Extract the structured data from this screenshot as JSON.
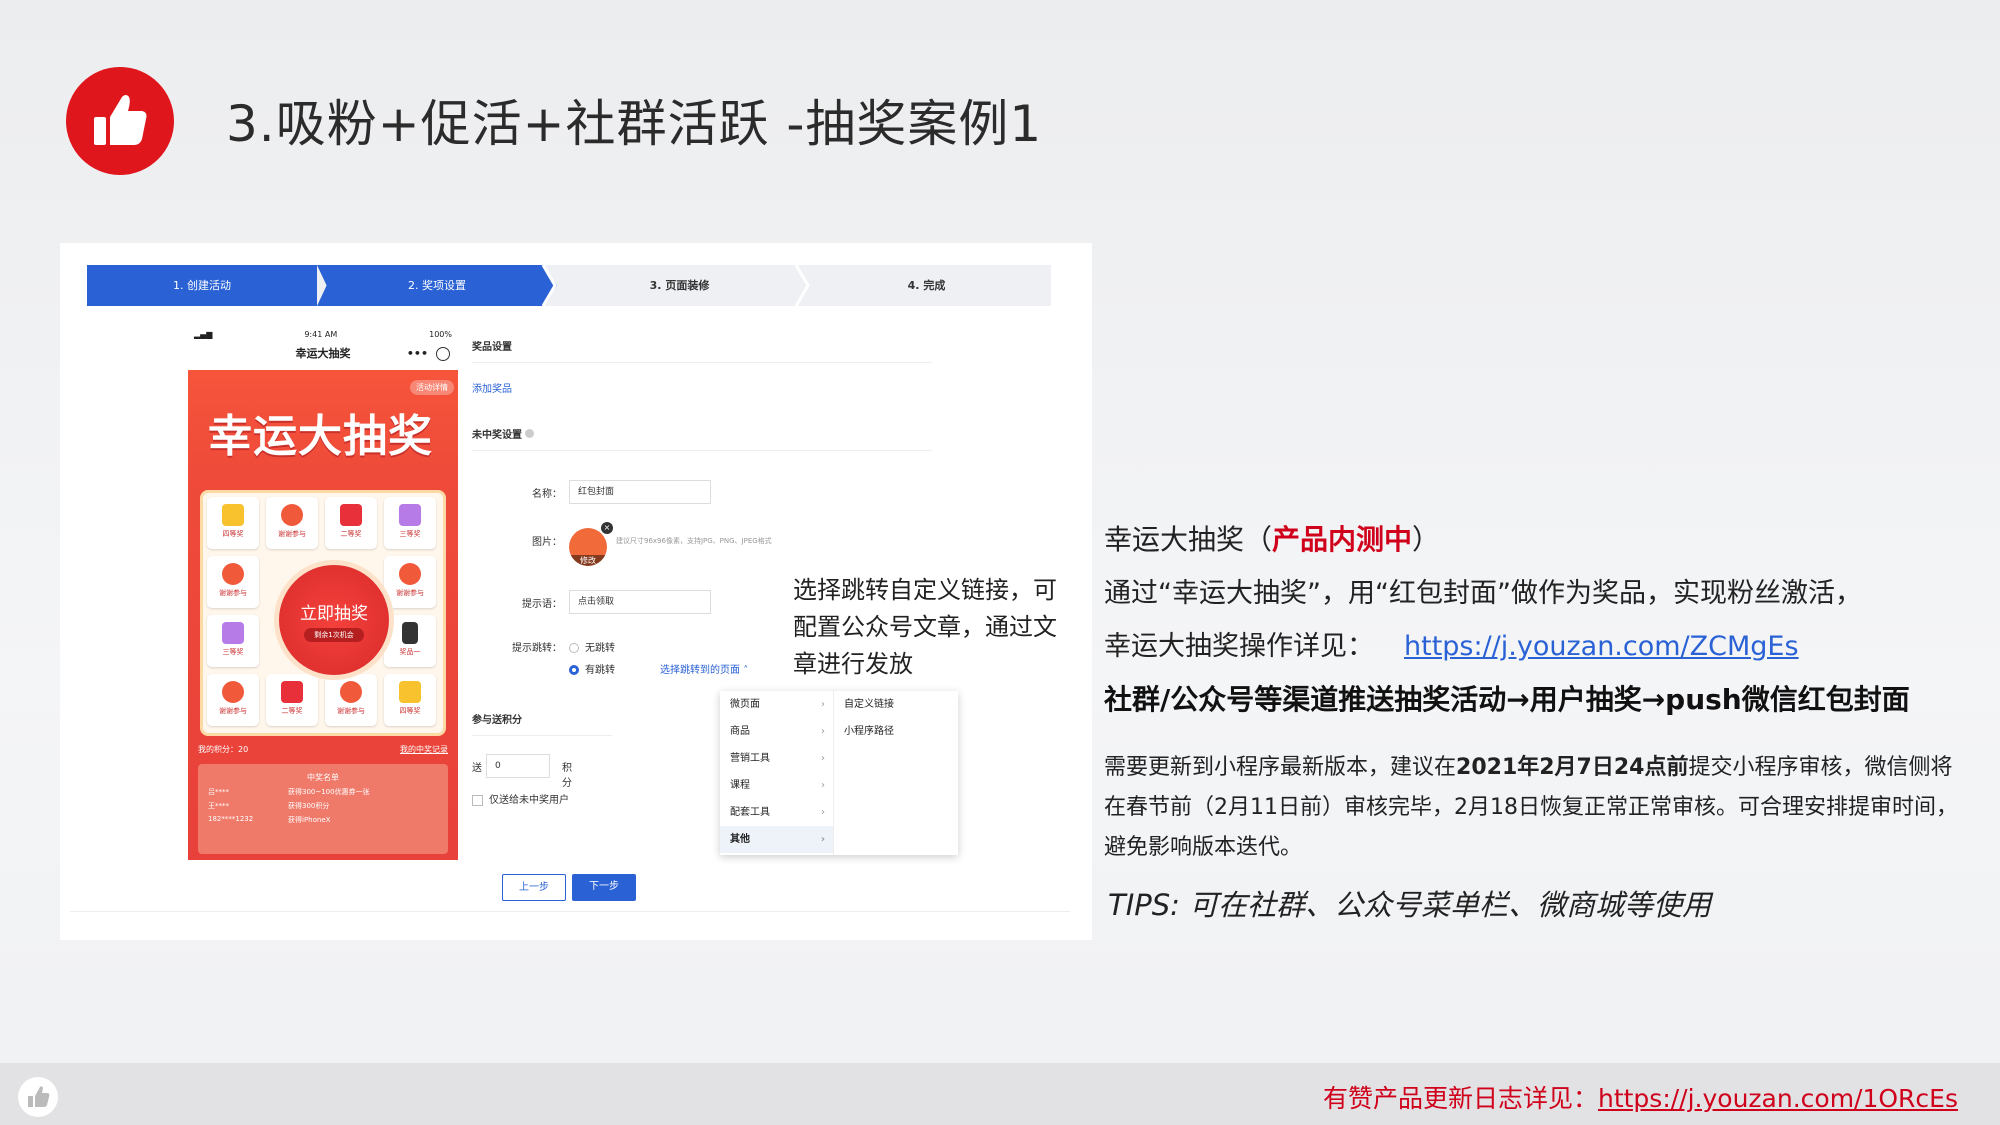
{
  "header": {
    "title": "3.吸粉+促活+社群活跃 -抽奖案例1"
  },
  "wizard": {
    "steps": [
      "1. 创建活动",
      "2. 奖项设置",
      "3. 页面装修",
      "4. 完成"
    ]
  },
  "phone": {
    "time": "9:41 AM",
    "battery": "100%",
    "title": "幸运大抽奖",
    "dots": "•••",
    "banner": "幸运大抽奖",
    "detail": "活动详情",
    "cells": [
      "四等奖",
      "谢谢参与",
      "二等奖",
      "三等奖",
      "谢谢参与",
      "谢谢参与",
      "三等奖",
      "奖品一",
      "谢谢参与",
      "二等奖",
      "谢谢参与",
      "四等奖"
    ],
    "draw_label": "立即抽奖",
    "draw_sub": "剩余1次机会",
    "score": "我的积分：20",
    "record": "我的中奖记录",
    "winners_title": "中奖名单",
    "winners": [
      {
        "name": "吕****",
        "prize": "获得300~100优惠券一张"
      },
      {
        "name": "王****",
        "prize": "获得300积分"
      },
      {
        "name": "182****1232",
        "prize": "获得iPhoneX"
      }
    ]
  },
  "form": {
    "prize_settings": "奖品设置",
    "add_prize": "添加奖品",
    "no_win_settings": "未中奖设置",
    "name_label": "名称：",
    "name_value": "红包封面",
    "image_label": "图片：",
    "image_edit": "修改",
    "image_hint": "建议尺寸96x96像素，支持JPG、PNG、JPEG格式",
    "tip_label": "提示语：",
    "tip_value": "点击领取",
    "jump_label": "提示跳转：",
    "no_jump": "无跳转",
    "has_jump": "有跳转",
    "choose_page": "选择跳转到的页面",
    "points_section": "参与送积分",
    "send_label": "送",
    "send_value": "0",
    "points_unit": "积分",
    "only_no_win": "仅送给未中奖用户",
    "menu_col1": [
      "微页面",
      "商品",
      "营销工具",
      "课程",
      "配套工具",
      "其他"
    ],
    "menu_col2": [
      "自定义链接",
      "小程序路径"
    ],
    "prev": "上一步",
    "next": "下一步"
  },
  "callout": "选择跳转自定义链接，可配置公众号文章，通过文章进行发放",
  "right": {
    "line1_a": "幸运大抽奖（",
    "line1_red": "产品内测中",
    "line1_b": "）",
    "line2": "通过“幸运大抽奖”，用“红包封面”做作为奖品，实现粉丝激活，",
    "line3_label": "幸运大抽奖操作详见：",
    "line3_link": "https://j.youzan.com/ZCMgEs",
    "line4": "社群/公众号等渠道推送抽奖活动→用户抽奖→push微信红包封面",
    "note_a": "需要更新到小程序最新版本，建议在",
    "note_bold": "2021年2月7日24点前",
    "note_b": "提交小程序审核，微信侧将在春节前（2月11日前）审核完毕，2月18日恢复正常正常审核。可合理安排提审时间，避免影响版本迭代。",
    "tips": "TIPS: 可在社群、公众号菜单栏、微商城等使用"
  },
  "footer": {
    "label": "有赞产品更新日志详见：",
    "link": "https://j.youzan.com/1ORcEs"
  },
  "colors": {
    "brand_red": "#e0161d",
    "accent_blue": "#2a62d6"
  }
}
